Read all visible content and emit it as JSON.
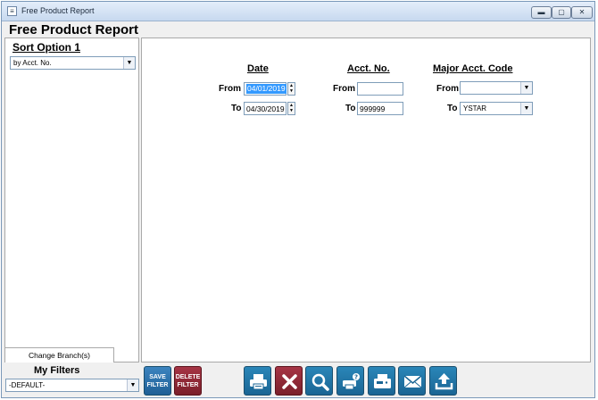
{
  "window": {
    "title": "Free Product Report",
    "minimize": "▬",
    "maximize": "▢",
    "close": "✕"
  },
  "report": {
    "title": "Free Product Report"
  },
  "sort": {
    "label": "Sort Option 1",
    "value": "by Acct. No."
  },
  "branch": {
    "label": "Change Branch(s)"
  },
  "date": {
    "header": "Date",
    "from_label": "From",
    "from_value": "04/01/2019",
    "to_label": "To",
    "to_value": "04/30/2019"
  },
  "acct": {
    "header": "Acct. No.",
    "from_label": "From",
    "from_value": "",
    "to_label": "To",
    "to_value": "999999"
  },
  "major": {
    "header": "Major Acct. Code",
    "from_label": "From",
    "from_value": "",
    "to_label": "To",
    "to_value": "YSTAR"
  },
  "filters": {
    "label": "My Filters",
    "value": "-DEFAULT-"
  },
  "buttons": {
    "save_line1": "SAVE",
    "save_line2": "FILTER",
    "delete_line1": "DELETE",
    "delete_line2": "FILTER",
    "icons": [
      "printer-icon",
      "close-icon",
      "search-icon",
      "print-preview-icon",
      "fax-icon",
      "email-icon",
      "export-icon"
    ]
  },
  "colors": {
    "button_blue": "#1f6fa0",
    "button_red": "#8b2332",
    "selection": "#3399ff"
  }
}
